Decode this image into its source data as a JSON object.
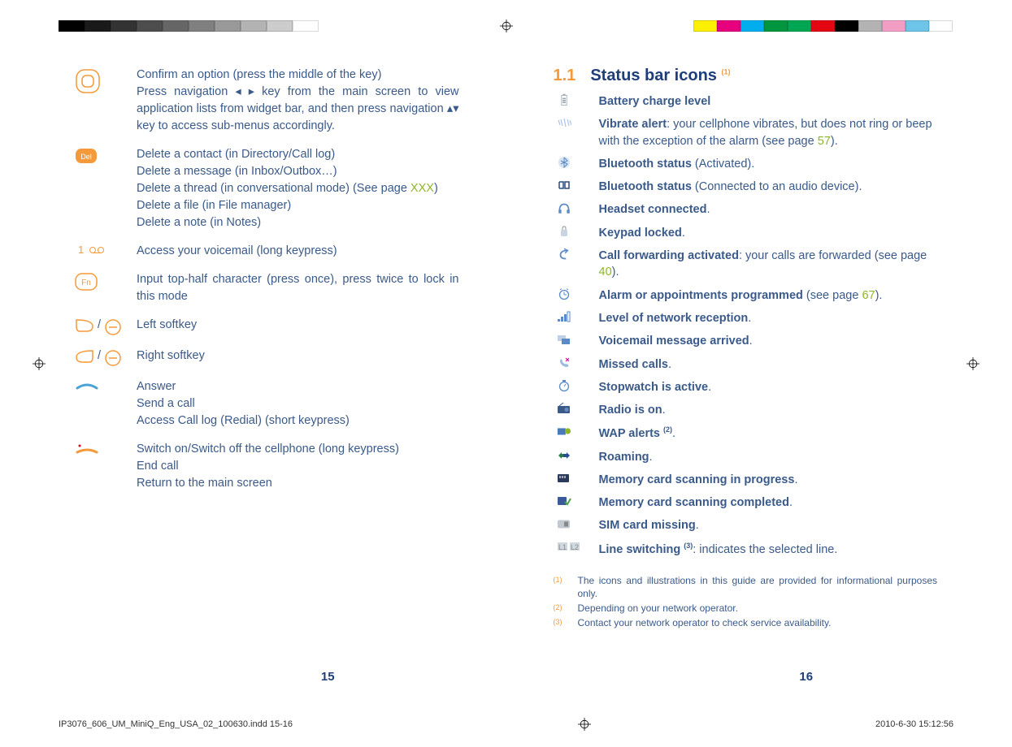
{
  "colorbars": {
    "left": [
      "#000",
      "#1a1a1a",
      "#333",
      "#4d4d4d",
      "#666",
      "#808080",
      "#999",
      "#b3b3b3",
      "#ccc",
      "#fff"
    ],
    "right": [
      "#fff000",
      "#e6007e",
      "#00aeef",
      "#009640",
      "#00a651",
      "#e30613",
      "#000",
      "#b3b3b3",
      "#f29ec4",
      "#6cc5e9",
      "#fff"
    ]
  },
  "left_page": {
    "items": [
      {
        "icon": "center-key",
        "lines": [
          "Confirm an option (press the middle of the key)",
          "Press navigation ◂ ▸ key from the main screen to view application lists from widget bar, and then press navigation ▴▾ key to access sub-menus accordingly."
        ]
      },
      {
        "icon": "del-key",
        "lines": [
          "Delete a contact (in Directory/Call log)",
          "Delete a message (in Inbox/Outbox…)",
          "Delete a thread (in conversational mode) (See page XXX)",
          "Delete a file (in File manager)",
          "Delete a note (in Notes)"
        ],
        "green_inline": "XXX"
      },
      {
        "icon": "voicemail-key",
        "lines": [
          "Access your voicemail (long keypress)"
        ]
      },
      {
        "icon": "fn-key",
        "lines": [
          "Input top-half character (press once), press twice to lock in this mode"
        ]
      },
      {
        "icon": "left-softkey",
        "lines": [
          "Left softkey"
        ]
      },
      {
        "icon": "right-softkey",
        "lines": [
          "Right softkey"
        ]
      },
      {
        "icon": "answer-key",
        "lines": [
          "Answer",
          "Send a call",
          "Access Call log (Redial) (short keypress)"
        ]
      },
      {
        "icon": "end-key",
        "lines": [
          "Switch on/Switch off the cellphone (long keypress)",
          "End call",
          "Return to the main screen"
        ]
      }
    ],
    "page_num": "15"
  },
  "right_page": {
    "section_num": "1.1",
    "section_title": "Status bar icons ",
    "section_sup": "(1)",
    "items": [
      {
        "icon": "battery",
        "bold": "Battery charge level",
        "rest": ""
      },
      {
        "icon": "vibrate",
        "bold": "Vibrate alert",
        "rest": ": your cellphone vibrates, but does not ring or beep with the exception of the alarm (see page ",
        "page": "57",
        "tail": ")."
      },
      {
        "icon": "bt-active",
        "bold": "Bluetooth status",
        "rest": " (Activated)."
      },
      {
        "icon": "bt-audio",
        "bold": "Bluetooth status",
        "rest": " (Connected to an audio device)."
      },
      {
        "icon": "headset",
        "bold": "Headset connected",
        "rest": "."
      },
      {
        "icon": "keypad",
        "bold": "Keypad locked",
        "rest": "."
      },
      {
        "icon": "fwd",
        "bold": "Call forwarding activated",
        "rest": ": your calls are forwarded (see page ",
        "page": "40",
        "tail": ")."
      },
      {
        "icon": "alarm",
        "bold": "Alarm or appointments programmed",
        "rest": " (see page ",
        "page": "67",
        "tail": ")."
      },
      {
        "icon": "signal",
        "bold": "Level of network reception",
        "rest": "."
      },
      {
        "icon": "vm",
        "bold": "Voicemail message arrived",
        "rest": "."
      },
      {
        "icon": "missed",
        "bold": "Missed calls",
        "rest": "."
      },
      {
        "icon": "stopwatch",
        "bold": "Stopwatch is active",
        "rest": "."
      },
      {
        "icon": "radio",
        "bold": "Radio is on",
        "rest": "."
      },
      {
        "icon": "wap",
        "bold": "WAP alerts ",
        "sup": "(2)",
        "rest": "."
      },
      {
        "icon": "roam",
        "bold": "Roaming",
        "rest": "."
      },
      {
        "icon": "mc-scan",
        "bold": "Memory card scanning in progress",
        "rest": "."
      },
      {
        "icon": "mc-done",
        "bold": "Memory card scanning completed",
        "rest": "."
      },
      {
        "icon": "sim",
        "bold": "SIM card missing",
        "rest": "."
      },
      {
        "icon": "line",
        "bold": "Line switching ",
        "sup": "(3)",
        "rest": ": indicates the selected line."
      }
    ],
    "footnotes": [
      {
        "sup": "(1)",
        "txt": "The icons and illustrations in this guide are provided for informational purposes only."
      },
      {
        "sup": "(2)",
        "txt": "Depending on your network operator."
      },
      {
        "sup": "(3)",
        "txt": "Contact your network operator to check service availability."
      }
    ],
    "page_num": "16"
  },
  "footer": {
    "file": "IP3076_606_UM_MiniQ_Eng_USA_02_100630.indd   15-16",
    "date": "2010-6-30   15:12:56"
  }
}
